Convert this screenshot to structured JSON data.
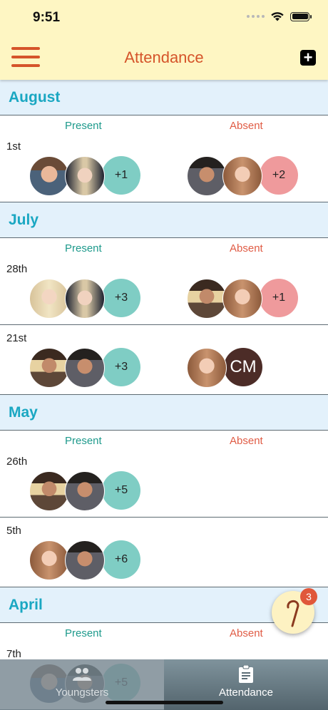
{
  "status": {
    "time": "9:51"
  },
  "header": {
    "title": "Attendance",
    "add_icon": "plus-square-icon",
    "menu_icon": "hamburger-icon"
  },
  "columns": {
    "present": "Present",
    "absent": "Absent"
  },
  "months": [
    {
      "name": "August",
      "days": [
        {
          "label": "1st",
          "present_count": "+1",
          "absent_count": "+2",
          "absent_initials": ""
        }
      ]
    },
    {
      "name": "July",
      "days": [
        {
          "label": "28th",
          "present_count": "+3",
          "absent_count": "+1",
          "absent_initials": ""
        },
        {
          "label": "21st",
          "present_count": "+3",
          "absent_count": "",
          "absent_initials": "CM"
        }
      ]
    },
    {
      "name": "May",
      "days": [
        {
          "label": "26th",
          "present_count": "+5"
        },
        {
          "label": "5th",
          "present_count": "+6"
        }
      ]
    },
    {
      "name": "April",
      "days": [
        {
          "label": "7th",
          "present_count": "+5"
        }
      ]
    }
  ],
  "fab": {
    "badge": "3",
    "icon": "shepherd-staff-icon"
  },
  "tabs": [
    {
      "label": "Youngsters",
      "icon": "people-icon",
      "selected": false
    },
    {
      "label": "Attendance",
      "icon": "clipboard-icon",
      "selected": true
    }
  ],
  "colors": {
    "accent": "#d5542a",
    "month": "#1aa7c2",
    "present": "#7fcdc4",
    "absent": "#ef9a9c"
  }
}
